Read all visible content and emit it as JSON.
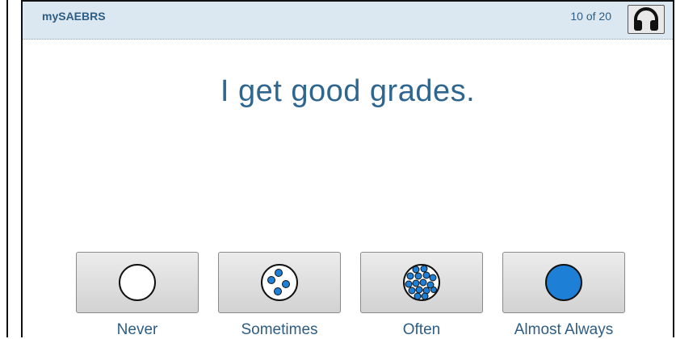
{
  "header": {
    "app_title": "mySAEBRS",
    "progress": "10 of 20",
    "audio_icon": "headphones-icon"
  },
  "question": {
    "text": "I get good grades."
  },
  "options": [
    {
      "label": "Never",
      "icon": "empty-circle-icon"
    },
    {
      "label": "Sometimes",
      "icon": "few-dots-circle-icon"
    },
    {
      "label": "Often",
      "icon": "many-dots-circle-icon"
    },
    {
      "label": "Almost Always",
      "icon": "filled-circle-icon"
    }
  ],
  "colors": {
    "accent": "#1d7fd6",
    "text": "#2d5d84",
    "header_bg": "#dce8f1"
  }
}
